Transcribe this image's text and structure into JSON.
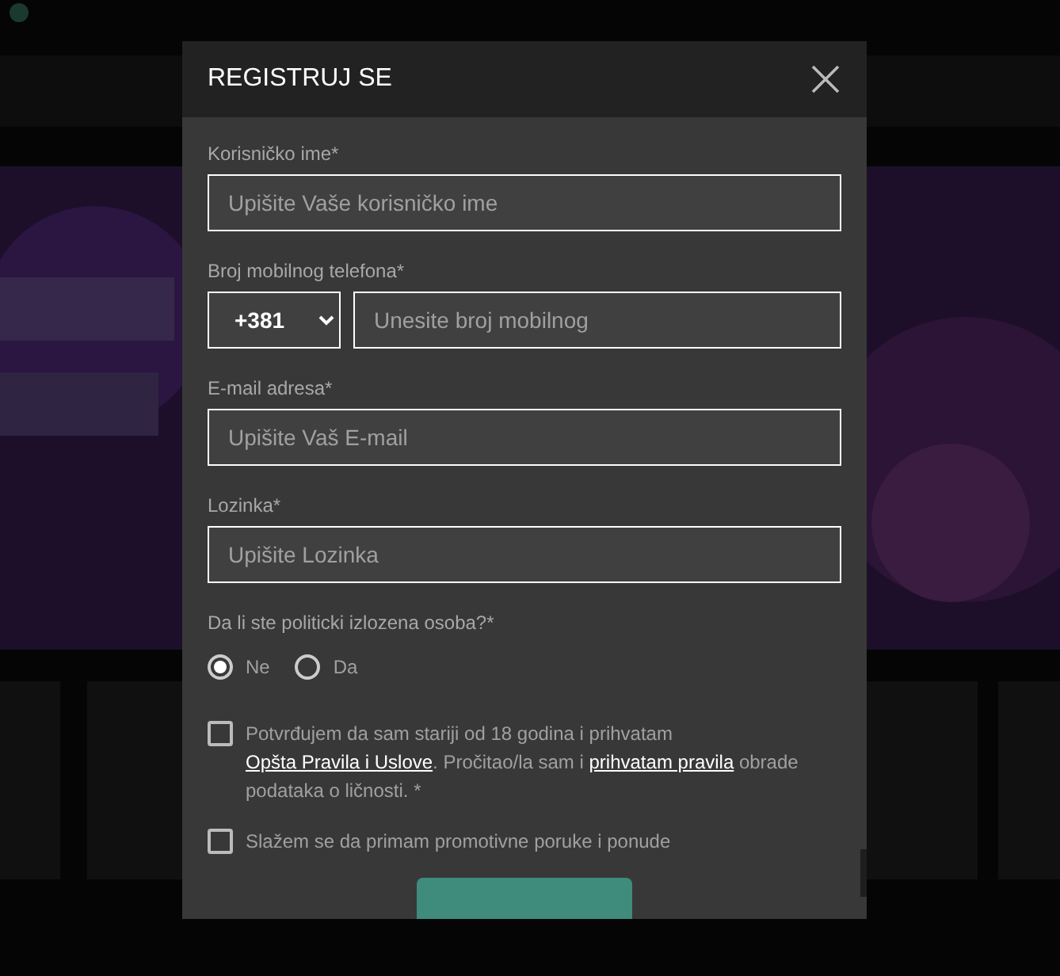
{
  "dialog": {
    "title": "REGISTRUJ SE",
    "fields": [
      {
        "kind": "text",
        "label": "Korisničko ime*",
        "placeholder": "Upišite Vaše korisničko ime"
      },
      {
        "kind": "phone",
        "label": "Broj mobilnog telefona*",
        "prefix": "+381",
        "placeholder": "Unesite broj mobilnog"
      },
      {
        "kind": "text",
        "label": "E-mail adresa*",
        "placeholder": "Upišite Vaš E-mail"
      },
      {
        "kind": "password",
        "label": "Lozinka*",
        "placeholder": "Upišite Lozinka"
      }
    ],
    "political": {
      "question": "Da li ste politicki izlozena osoba?*",
      "options": [
        {
          "label": "Ne",
          "selected": true
        },
        {
          "label": "Da",
          "selected": false
        }
      ]
    },
    "consents": [
      {
        "checked": false,
        "parts": [
          {
            "kind": "text",
            "text": "Potvrđujem da sam stariji od 18 godina i prihvatam "
          },
          {
            "kind": "link",
            "text": "Opšta Pravila i Uslove"
          },
          {
            "kind": "text",
            "text": ". Pročitao/la sam i "
          },
          {
            "kind": "link",
            "text": "prihvatam pravila"
          },
          {
            "kind": "text",
            "text": " obrade podataka o ličnosti. *"
          }
        ]
      },
      {
        "checked": false,
        "parts": [
          {
            "kind": "text",
            "text": "Slažem se da primam promotivne poruke i ponude"
          }
        ]
      }
    ]
  }
}
